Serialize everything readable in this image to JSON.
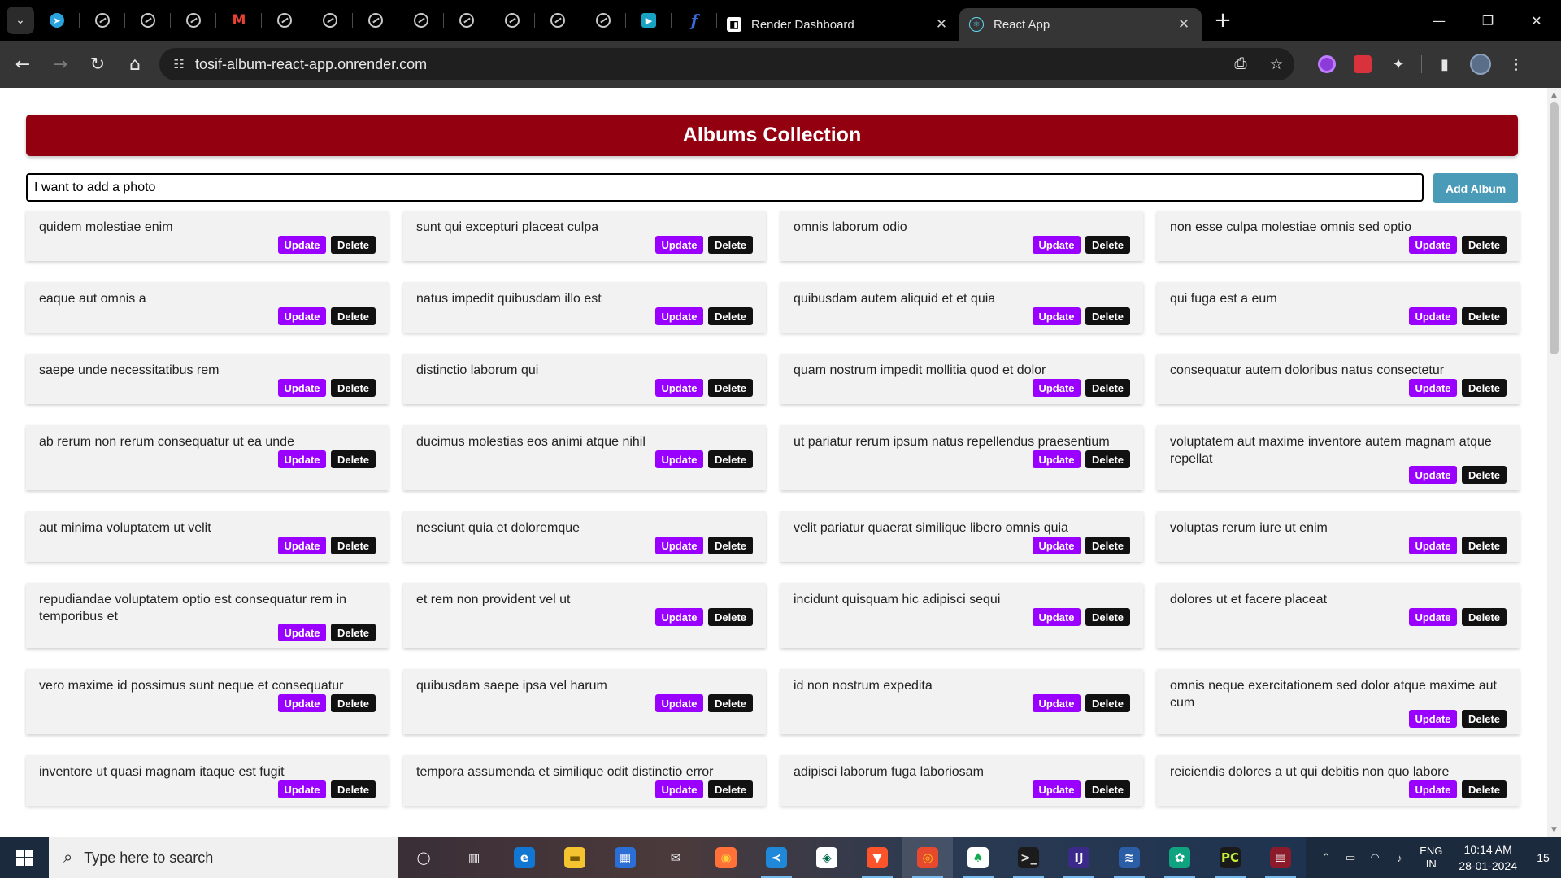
{
  "browser": {
    "tabs": [
      {
        "title": "Render Dashboard",
        "favicon": "render-icon",
        "active": false
      },
      {
        "title": "React App",
        "favicon": "react-icon",
        "active": true
      }
    ],
    "pinned_tabs": [
      "telegram-icon",
      "globe-icon",
      "globe-icon",
      "globe-icon",
      "gmail-icon",
      "globe-icon",
      "globe-icon",
      "globe-icon",
      "globe-icon",
      "globe-icon",
      "globe-icon",
      "globe-icon",
      "globe-icon",
      "meet-icon",
      "facebook-icon"
    ],
    "url": "tosif-album-react-app.onrender.com"
  },
  "app": {
    "title": "Albums Collection",
    "input_value": "I want to add a photo",
    "add_button": "Add Album",
    "update_label": "Update",
    "delete_label": "Delete",
    "colors": {
      "header": "#930010",
      "update": "#9900ff",
      "delete": "#111111",
      "add": "#4a9bb8"
    },
    "albums": [
      "quidem molestiae enim",
      "sunt qui excepturi placeat culpa",
      "omnis laborum odio",
      "non esse culpa molestiae omnis sed optio",
      "eaque aut omnis a",
      "natus impedit quibusdam illo est",
      "quibusdam autem aliquid et et quia",
      "qui fuga est a eum",
      "saepe unde necessitatibus rem",
      "distinctio laborum qui",
      "quam nostrum impedit mollitia quod et dolor",
      "consequatur autem doloribus natus consectetur",
      "ab rerum non rerum consequatur ut ea unde",
      "ducimus molestias eos animi atque nihil",
      "ut pariatur rerum ipsum natus repellendus praesentium",
      "voluptatem aut maxime inventore autem magnam atque repellat",
      "aut minima voluptatem ut velit",
      "nesciunt quia et doloremque",
      "velit pariatur quaerat similique libero omnis quia",
      "voluptas rerum iure ut enim",
      "repudiandae voluptatem optio est consequatur rem in temporibus et",
      "et rem non provident vel ut",
      "incidunt quisquam hic adipisci sequi",
      "dolores ut et facere placeat",
      "vero maxime id possimus sunt neque et consequatur",
      "quibusdam saepe ipsa vel harum",
      "id non nostrum expedita",
      "omnis neque exercitationem sed dolor atque maxime aut cum",
      "inventore ut quasi magnam itaque est fugit",
      "tempora assumenda et similique odit distinctio error",
      "adipisci laborum fuga laboriosam",
      "reiciendis dolores a ut qui debitis non quo labore"
    ]
  },
  "taskbar": {
    "search_placeholder": "Type here to search",
    "apps": [
      "cortana-icon",
      "task-view-icon",
      "edge-icon",
      "file-explorer-icon",
      "store-icon",
      "mail-icon",
      "firefox-icon",
      "vscode-icon",
      "compass-icon",
      "brave-icon",
      "chrome-icon",
      "mongodb-icon",
      "terminal-icon",
      "intellij-icon",
      "mysql-icon",
      "chatgpt-icon",
      "pycharm-icon",
      "winrar-icon"
    ],
    "language": "ENG",
    "region": "IN",
    "time": "10:14 AM",
    "date": "28-01-2024",
    "notifications": "15"
  }
}
